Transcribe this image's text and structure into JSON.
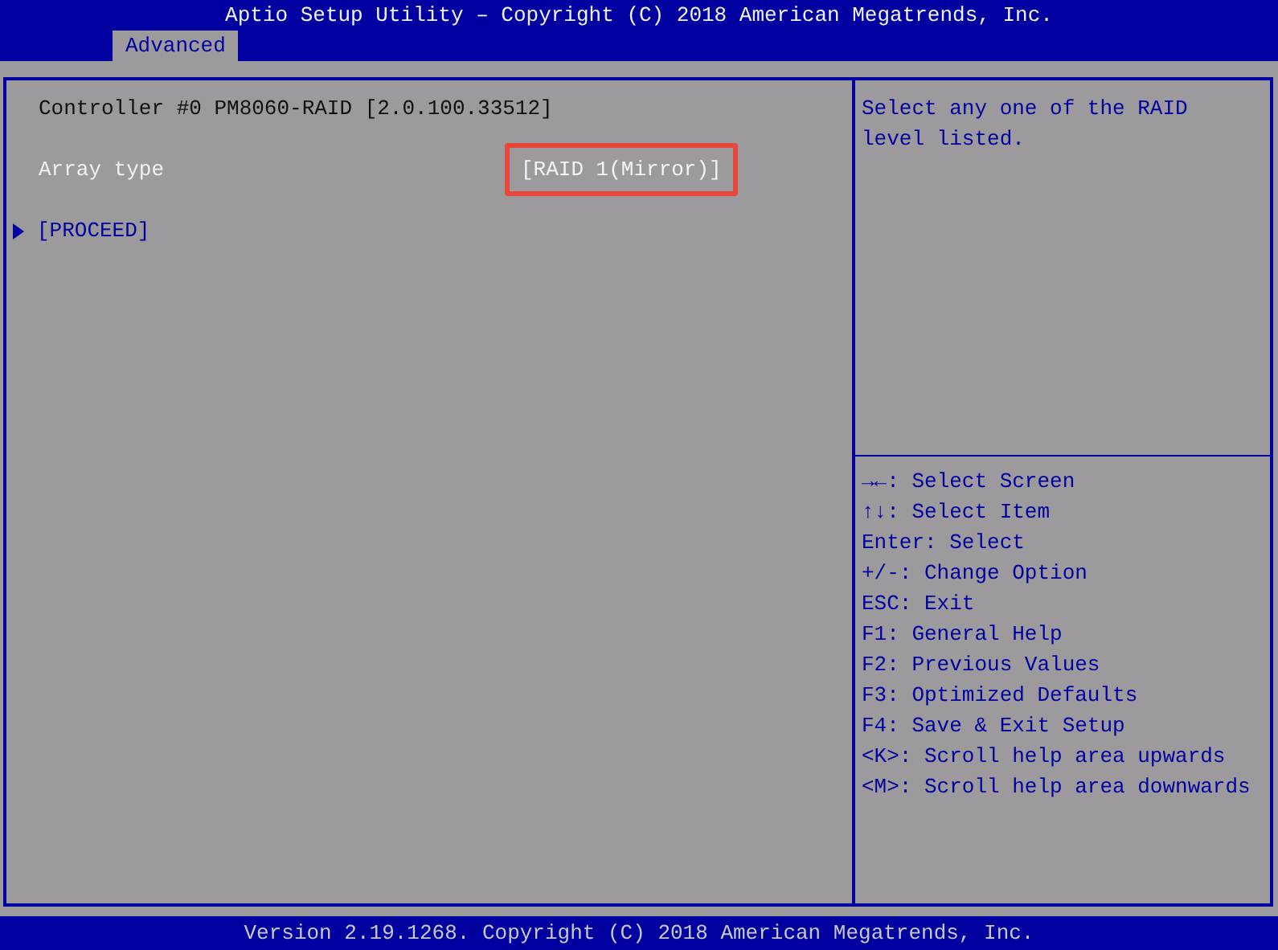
{
  "window": {
    "title": "Aptio Setup Utility – Copyright (C) 2018 American Megatrends, Inc."
  },
  "tabs": [
    {
      "label": "Advanced",
      "selected": true
    }
  ],
  "items": [
    {
      "kind": "text",
      "label": "Controller #0 PM8060-RAID [2.0.100.33512]"
    },
    {
      "kind": "setting",
      "label": "Array type",
      "value": "[RAID 1(Mirror)]",
      "focused": true,
      "highlighted": true
    },
    {
      "kind": "submenu",
      "label": "[PROCEED]"
    }
  ],
  "help": {
    "text": "Select any one of the RAID level listed.",
    "keys": [
      {
        "key": "→←",
        "text": ": Select Screen"
      },
      {
        "key": "↑↓",
        "text": ": Select Item"
      },
      {
        "text": "Enter: Select"
      },
      {
        "text": "+/-: Change Option"
      },
      {
        "text": "ESC: Exit"
      },
      {
        "text": "F1: General Help"
      },
      {
        "text": "F2: Previous Values"
      },
      {
        "text": "F3: Optimized Defaults"
      },
      {
        "text": "F4: Save & Exit Setup"
      },
      {
        "text": "<K>: Scroll help area upwards"
      },
      {
        "text": "<M>: Scroll help area downwards"
      }
    ]
  },
  "status_bar": "Version 2.19.1268. Copyright (C) 2018 American Megatrends, Inc."
}
